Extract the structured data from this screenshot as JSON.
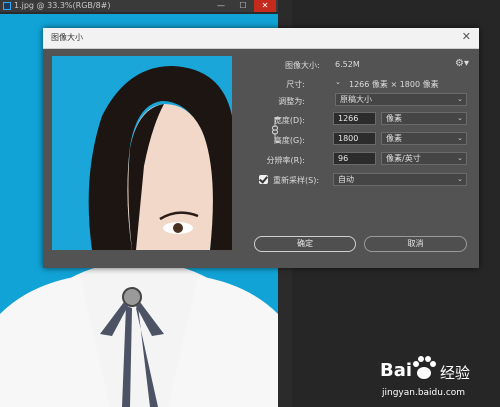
{
  "document": {
    "title": "1.jpg @ 33.3%(RGB/8#)"
  },
  "window_buttons": {
    "minimize": "—",
    "maximize": "☐",
    "close": "✕"
  },
  "dialog": {
    "title": "图像大小",
    "close": "✕",
    "image_size_label": "图像大小:",
    "image_size_value": "6.52M",
    "dimensions_label": "尺寸:",
    "dimensions_value": "1266 像素 × 1800 像素",
    "fit_to_label": "调整为:",
    "fit_to_value": "原稿大小",
    "width_label": "宽度(D):",
    "width_value": "1266",
    "width_unit": "像素",
    "height_label": "高度(G):",
    "height_value": "1800",
    "height_unit": "像素",
    "resolution_label": "分辨率(R):",
    "resolution_value": "96",
    "resolution_unit": "像素/英寸",
    "resample_label": "重新采样(S):",
    "resample_checked": true,
    "resample_value": "自动",
    "ok_label": "确定",
    "cancel_label": "取消"
  },
  "watermark": {
    "brand": "Bai",
    "brand2": "经验",
    "url": "jingyan.baidu.com"
  },
  "colors": {
    "canvas_bg": "#11a3d6",
    "dialog_bg": "#535353",
    "accent": "#31a8ff"
  }
}
